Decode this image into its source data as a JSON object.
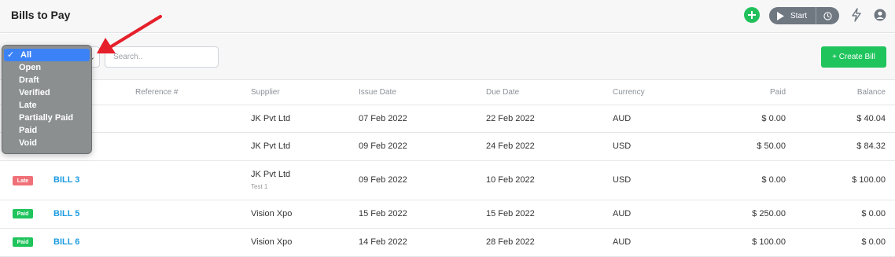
{
  "header": {
    "title": "Bills to Pay",
    "start_label": "Start"
  },
  "filters": {
    "status_selected": "All",
    "status_options": [
      "All",
      "Open",
      "Draft",
      "Verified",
      "Late",
      "Partially Paid",
      "Paid",
      "Void"
    ],
    "search_placeholder": "Search..",
    "create_button_label": "+ Create Bill"
  },
  "table": {
    "columns": {
      "reference": "Reference #",
      "supplier": "Supplier",
      "issue_date": "Issue Date",
      "due_date": "Due Date",
      "currency": "Currency",
      "paid": "Paid",
      "balance": "Balance"
    },
    "rows": [
      {
        "status": "",
        "bill": "",
        "supplier": "JK Pvt Ltd",
        "supplier_note": "",
        "issue_date": "07 Feb 2022",
        "due_date": "22 Feb 2022",
        "currency": "AUD",
        "paid": "$ 0.00",
        "balance": "$ 40.04"
      },
      {
        "status": "",
        "bill": "",
        "supplier": "JK Pvt Ltd",
        "supplier_note": "",
        "issue_date": "09 Feb 2022",
        "due_date": "24 Feb 2022",
        "currency": "USD",
        "paid": "$ 50.00",
        "balance": "$ 84.32"
      },
      {
        "status": "Late",
        "bill": "BILL 3",
        "supplier": "JK Pvt Ltd",
        "supplier_note": "Test 1",
        "issue_date": "09 Feb 2022",
        "due_date": "10 Feb 2022",
        "currency": "USD",
        "paid": "$ 0.00",
        "balance": "$ 100.00"
      },
      {
        "status": "Paid",
        "bill": "BILL 5",
        "supplier": "Vision Xpo",
        "supplier_note": "",
        "issue_date": "15 Feb 2022",
        "due_date": "15 Feb 2022",
        "currency": "AUD",
        "paid": "$ 250.00",
        "balance": "$ 0.00"
      },
      {
        "status": "Paid",
        "bill": "BILL 6",
        "supplier": "Vision Xpo",
        "supplier_note": "",
        "issue_date": "14 Feb 2022",
        "due_date": "28 Feb 2022",
        "currency": "AUD",
        "paid": "$ 100.00",
        "balance": "$ 0.00"
      }
    ]
  },
  "colors": {
    "late": "#f07078",
    "paid": "#1fc45c",
    "link": "#1b9be0",
    "accent_green": "#21c05b",
    "arrow": "#e5202a"
  }
}
